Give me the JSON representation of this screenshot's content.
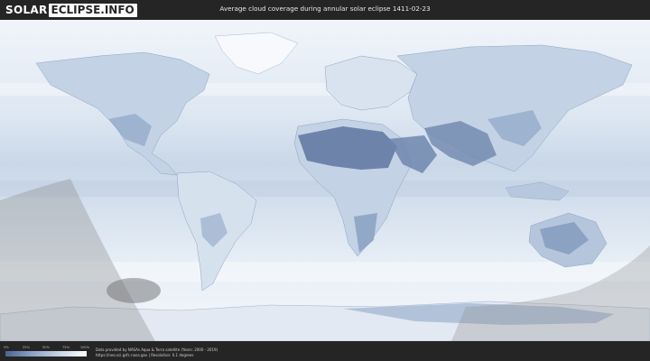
{
  "header": {
    "logo_left": "SOLAR",
    "logo_right": "ECLIPSE.INFO",
    "title": "Average cloud coverage during annular solar eclipse 1411-02-23"
  },
  "legend": {
    "ticks": [
      "0%",
      "25%",
      "50%",
      "75%",
      "100%"
    ],
    "colors": [
      "#4d6590",
      "#8ca3c4",
      "#c7d4e6",
      "#ffffff"
    ]
  },
  "footer": {
    "credit_line1": "Data provided by NASAs Aqua & Terra satellite (Years: 2000 - 2019)",
    "credit_line2": "https://neo.sci.gsfc.nasa.gov | Resolution: 0.1 degrees"
  },
  "colors": {
    "background": "#252525",
    "ocean_clear": "#d9e4f0",
    "land_dry": "#5e76a0",
    "eclipse_shade": "#9e9e9e"
  }
}
